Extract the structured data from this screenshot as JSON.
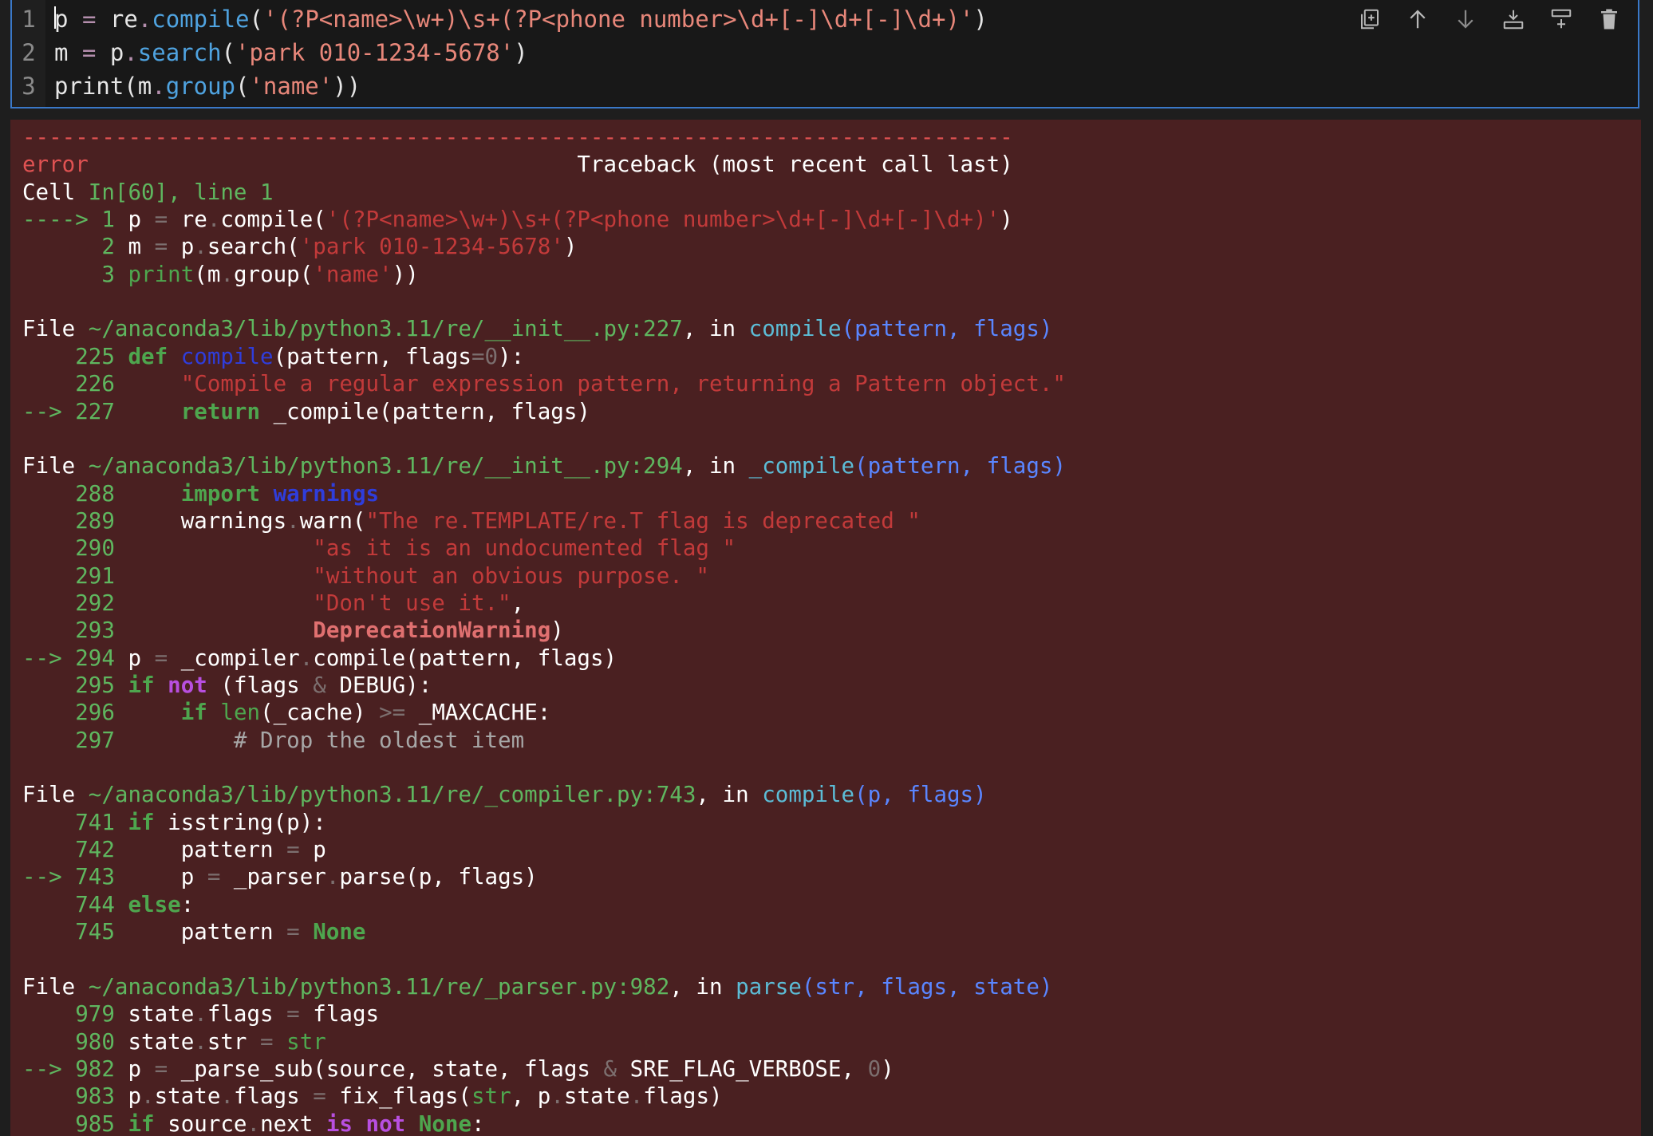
{
  "input_cell": {
    "lines": [
      {
        "no": "1",
        "parts": [
          {
            "t": "p",
            "c": "k-id"
          },
          {
            "t": " ",
            "c": "k-id"
          },
          {
            "t": "=",
            "c": "k-op"
          },
          {
            "t": " re",
            "c": "k-id"
          },
          {
            "t": ".",
            "c": "k-op"
          },
          {
            "t": "compile",
            "c": "k-fn"
          },
          {
            "t": "(",
            "c": "k-id"
          },
          {
            "t": "'(?P<name>\\w+)\\s+(?P<phone number>\\d+[-]\\d+[-]\\d+)'",
            "c": "k-str"
          },
          {
            "t": ")",
            "c": "k-id"
          }
        ]
      },
      {
        "no": "2",
        "parts": [
          {
            "t": "m ",
            "c": "k-id"
          },
          {
            "t": "=",
            "c": "k-op"
          },
          {
            "t": " p",
            "c": "k-id"
          },
          {
            "t": ".",
            "c": "k-op"
          },
          {
            "t": "search",
            "c": "k-fn"
          },
          {
            "t": "(",
            "c": "k-id"
          },
          {
            "t": "'park 010-1234-5678'",
            "c": "k-str"
          },
          {
            "t": ")",
            "c": "k-id"
          }
        ]
      },
      {
        "no": "3",
        "parts": [
          {
            "t": "print(m",
            "c": "k-id"
          },
          {
            "t": ".",
            "c": "k-op"
          },
          {
            "t": "group",
            "c": "k-fn"
          },
          {
            "t": "(",
            "c": "k-id"
          },
          {
            "t": "'name'",
            "c": "k-str"
          },
          {
            "t": "))",
            "c": "k-id"
          }
        ]
      }
    ]
  },
  "toolbar": {
    "buttons": [
      {
        "name": "copy-cell-button",
        "icon": "copy-icon",
        "title": "Copy"
      },
      {
        "name": "move-up-button",
        "icon": "arrow-up-icon",
        "title": "Move up"
      },
      {
        "name": "move-down-button",
        "icon": "arrow-down-icon",
        "title": "Move down"
      },
      {
        "name": "insert-above-button",
        "icon": "insert-above-icon",
        "title": "Insert above"
      },
      {
        "name": "insert-below-button",
        "icon": "insert-below-icon",
        "title": "Insert below"
      },
      {
        "name": "delete-cell-button",
        "icon": "trash-icon",
        "title": "Delete"
      }
    ]
  },
  "output": {
    "lines": [
      [
        {
          "t": "---------------------------------------------------------------------------",
          "c": "c-red"
        }
      ],
      [
        {
          "t": "error",
          "c": "c-red"
        },
        {
          "t": "                                     Traceback (most recent call last)",
          "c": "c-w"
        }
      ],
      [
        {
          "t": "Cell ",
          "c": "c-w"
        },
        {
          "t": "In[60], line 1",
          "c": "c-green"
        }
      ],
      [
        {
          "t": "----> 1",
          "c": "c-green"
        },
        {
          "t": " p ",
          "c": "c-w"
        },
        {
          "t": "=",
          "c": "c-gray"
        },
        {
          "t": " re",
          "c": "c-w"
        },
        {
          "t": ".",
          "c": "c-gray"
        },
        {
          "t": "compile(",
          "c": "c-w"
        },
        {
          "t": "'(?P<name>\\w+)\\s+(?P<phone number>\\d+[-]\\d+[-]\\d+)'",
          "c": "c-dred"
        },
        {
          "t": ")",
          "c": "c-w"
        }
      ],
      [
        {
          "t": "      2",
          "c": "c-green"
        },
        {
          "t": " m ",
          "c": "c-w"
        },
        {
          "t": "=",
          "c": "c-gray"
        },
        {
          "t": " p",
          "c": "c-w"
        },
        {
          "t": ".",
          "c": "c-gray"
        },
        {
          "t": "search(",
          "c": "c-w"
        },
        {
          "t": "'park 010-1234-5678'",
          "c": "c-dred"
        },
        {
          "t": ")",
          "c": "c-w"
        }
      ],
      [
        {
          "t": "      3",
          "c": "c-green"
        },
        {
          "t": " ",
          "c": "c-w"
        },
        {
          "t": "print",
          "c": "c-dgreen"
        },
        {
          "t": "(m",
          "c": "c-w"
        },
        {
          "t": ".",
          "c": "c-gray"
        },
        {
          "t": "group(",
          "c": "c-w"
        },
        {
          "t": "'name'",
          "c": "c-dred"
        },
        {
          "t": "))",
          "c": "c-w"
        }
      ],
      [
        {
          "t": "",
          "c": "c-w"
        }
      ],
      [
        {
          "t": "File ",
          "c": "c-w"
        },
        {
          "t": "~/anaconda3/lib/python3.11/re/__init__.py:227",
          "c": "c-green"
        },
        {
          "t": ", in ",
          "c": "c-w"
        },
        {
          "t": "compile",
          "c": "c-cyan"
        },
        {
          "t": "(pattern, flags)",
          "c": "c-blue"
        }
      ],
      [
        {
          "t": "    225",
          "c": "c-green"
        },
        {
          "t": " ",
          "c": "c-w"
        },
        {
          "t": "def",
          "c": "c-dgreen b"
        },
        {
          "t": " ",
          "c": "c-w"
        },
        {
          "t": "compile",
          "c": "c-dblue"
        },
        {
          "t": "(pattern, flags",
          "c": "c-w"
        },
        {
          "t": "=",
          "c": "c-gray"
        },
        {
          "t": "0",
          "c": "c-gray"
        },
        {
          "t": "):",
          "c": "c-w"
        }
      ],
      [
        {
          "t": "    226",
          "c": "c-green"
        },
        {
          "t": "     ",
          "c": "c-w"
        },
        {
          "t": "\"Compile a regular expression pattern, returning a Pattern object.\"",
          "c": "c-dred"
        }
      ],
      [
        {
          "t": "--> 227",
          "c": "c-green"
        },
        {
          "t": "     ",
          "c": "c-w"
        },
        {
          "t": "return",
          "c": "c-dgreen b"
        },
        {
          "t": " _compile(pattern, flags)",
          "c": "c-w"
        }
      ],
      [
        {
          "t": "",
          "c": "c-w"
        }
      ],
      [
        {
          "t": "File ",
          "c": "c-w"
        },
        {
          "t": "~/anaconda3/lib/python3.11/re/__init__.py:294",
          "c": "c-green"
        },
        {
          "t": ", in ",
          "c": "c-w"
        },
        {
          "t": "_compile",
          "c": "c-cyan"
        },
        {
          "t": "(pattern, flags)",
          "c": "c-blue"
        }
      ],
      [
        {
          "t": "    288",
          "c": "c-green"
        },
        {
          "t": "     ",
          "c": "c-w"
        },
        {
          "t": "import",
          "c": "c-dgreen b"
        },
        {
          "t": " ",
          "c": "c-w"
        },
        {
          "t": "warnings",
          "c": "c-dblue b"
        }
      ],
      [
        {
          "t": "    289",
          "c": "c-green"
        },
        {
          "t": "     warnings",
          "c": "c-w"
        },
        {
          "t": ".",
          "c": "c-gray"
        },
        {
          "t": "warn(",
          "c": "c-w"
        },
        {
          "t": "\"The re.TEMPLATE/re.T flag is deprecated \"",
          "c": "c-dred"
        }
      ],
      [
        {
          "t": "    290",
          "c": "c-green"
        },
        {
          "t": "               ",
          "c": "c-w"
        },
        {
          "t": "\"as it is an undocumented flag \"",
          "c": "c-dred"
        }
      ],
      [
        {
          "t": "    291",
          "c": "c-green"
        },
        {
          "t": "               ",
          "c": "c-w"
        },
        {
          "t": "\"without an obvious purpose. \"",
          "c": "c-dred"
        }
      ],
      [
        {
          "t": "    292",
          "c": "c-green"
        },
        {
          "t": "               ",
          "c": "c-w"
        },
        {
          "t": "\"Don't use it.\"",
          "c": "c-dred"
        },
        {
          "t": ",",
          "c": "c-w"
        }
      ],
      [
        {
          "t": "    293",
          "c": "c-green"
        },
        {
          "t": "               ",
          "c": "c-w"
        },
        {
          "t": "DeprecationWarning",
          "c": "c-orange b"
        },
        {
          "t": ")",
          "c": "c-w"
        }
      ],
      [
        {
          "t": "--> 294",
          "c": "c-green"
        },
        {
          "t": " p ",
          "c": "c-w"
        },
        {
          "t": "=",
          "c": "c-gray"
        },
        {
          "t": " _compiler",
          "c": "c-w"
        },
        {
          "t": ".",
          "c": "c-gray"
        },
        {
          "t": "compile(pattern, flags)",
          "c": "c-w"
        }
      ],
      [
        {
          "t": "    295",
          "c": "c-green"
        },
        {
          "t": " ",
          "c": "c-w"
        },
        {
          "t": "if",
          "c": "c-dgreen b"
        },
        {
          "t": " ",
          "c": "c-w"
        },
        {
          "t": "not",
          "c": "c-purple b"
        },
        {
          "t": " (flags ",
          "c": "c-w"
        },
        {
          "t": "&",
          "c": "c-gray"
        },
        {
          "t": " DEBUG):",
          "c": "c-w"
        }
      ],
      [
        {
          "t": "    296",
          "c": "c-green"
        },
        {
          "t": "     ",
          "c": "c-w"
        },
        {
          "t": "if",
          "c": "c-dgreen b"
        },
        {
          "t": " ",
          "c": "c-w"
        },
        {
          "t": "len",
          "c": "c-dgreen"
        },
        {
          "t": "(_cache) ",
          "c": "c-w"
        },
        {
          "t": ">=",
          "c": "c-gray"
        },
        {
          "t": " _MAXCACHE:",
          "c": "c-w"
        }
      ],
      [
        {
          "t": "    297",
          "c": "c-green"
        },
        {
          "t": "         ",
          "c": "c-w"
        },
        {
          "t": "# Drop the oldest item",
          "c": "c-comment"
        }
      ],
      [
        {
          "t": "",
          "c": "c-w"
        }
      ],
      [
        {
          "t": "File ",
          "c": "c-w"
        },
        {
          "t": "~/anaconda3/lib/python3.11/re/_compiler.py:743",
          "c": "c-green"
        },
        {
          "t": ", in ",
          "c": "c-w"
        },
        {
          "t": "compile",
          "c": "c-cyan"
        },
        {
          "t": "(p, flags)",
          "c": "c-blue"
        }
      ],
      [
        {
          "t": "    741",
          "c": "c-green"
        },
        {
          "t": " ",
          "c": "c-w"
        },
        {
          "t": "if",
          "c": "c-dgreen b"
        },
        {
          "t": " isstring(p):",
          "c": "c-w"
        }
      ],
      [
        {
          "t": "    742",
          "c": "c-green"
        },
        {
          "t": "     pattern ",
          "c": "c-w"
        },
        {
          "t": "=",
          "c": "c-gray"
        },
        {
          "t": " p",
          "c": "c-w"
        }
      ],
      [
        {
          "t": "--> 743",
          "c": "c-green"
        },
        {
          "t": "     p ",
          "c": "c-w"
        },
        {
          "t": "=",
          "c": "c-gray"
        },
        {
          "t": " _parser",
          "c": "c-w"
        },
        {
          "t": ".",
          "c": "c-gray"
        },
        {
          "t": "parse(p, flags)",
          "c": "c-w"
        }
      ],
      [
        {
          "t": "    744",
          "c": "c-green"
        },
        {
          "t": " ",
          "c": "c-w"
        },
        {
          "t": "else",
          "c": "c-dgreen b"
        },
        {
          "t": ":",
          "c": "c-w"
        }
      ],
      [
        {
          "t": "    745",
          "c": "c-green"
        },
        {
          "t": "     pattern ",
          "c": "c-w"
        },
        {
          "t": "=",
          "c": "c-gray"
        },
        {
          "t": " ",
          "c": "c-w"
        },
        {
          "t": "None",
          "c": "c-dgreen b"
        }
      ],
      [
        {
          "t": "",
          "c": "c-w"
        }
      ],
      [
        {
          "t": "File ",
          "c": "c-w"
        },
        {
          "t": "~/anaconda3/lib/python3.11/re/_parser.py:982",
          "c": "c-green"
        },
        {
          "t": ", in ",
          "c": "c-w"
        },
        {
          "t": "parse",
          "c": "c-cyan"
        },
        {
          "t": "(str, flags, state)",
          "c": "c-blue"
        }
      ],
      [
        {
          "t": "    979",
          "c": "c-green"
        },
        {
          "t": " state",
          "c": "c-w"
        },
        {
          "t": ".",
          "c": "c-gray"
        },
        {
          "t": "flags ",
          "c": "c-w"
        },
        {
          "t": "=",
          "c": "c-gray"
        },
        {
          "t": " flags",
          "c": "c-w"
        }
      ],
      [
        {
          "t": "    980",
          "c": "c-green"
        },
        {
          "t": " state",
          "c": "c-w"
        },
        {
          "t": ".",
          "c": "c-gray"
        },
        {
          "t": "str ",
          "c": "c-w"
        },
        {
          "t": "=",
          "c": "c-gray"
        },
        {
          "t": " ",
          "c": "c-w"
        },
        {
          "t": "str",
          "c": "c-dgreen"
        }
      ],
      [
        {
          "t": "--> 982",
          "c": "c-green"
        },
        {
          "t": " p ",
          "c": "c-w"
        },
        {
          "t": "=",
          "c": "c-gray"
        },
        {
          "t": " _parse_sub(source, state, flags ",
          "c": "c-w"
        },
        {
          "t": "&",
          "c": "c-gray"
        },
        {
          "t": " SRE_FLAG_VERBOSE, ",
          "c": "c-w"
        },
        {
          "t": "0",
          "c": "c-gray"
        },
        {
          "t": ")",
          "c": "c-w"
        }
      ],
      [
        {
          "t": "    983",
          "c": "c-green"
        },
        {
          "t": " p",
          "c": "c-w"
        },
        {
          "t": ".",
          "c": "c-gray"
        },
        {
          "t": "state",
          "c": "c-w"
        },
        {
          "t": ".",
          "c": "c-gray"
        },
        {
          "t": "flags ",
          "c": "c-w"
        },
        {
          "t": "=",
          "c": "c-gray"
        },
        {
          "t": " fix_flags(",
          "c": "c-w"
        },
        {
          "t": "str",
          "c": "c-dgreen"
        },
        {
          "t": ", p",
          "c": "c-w"
        },
        {
          "t": ".",
          "c": "c-gray"
        },
        {
          "t": "state",
          "c": "c-w"
        },
        {
          "t": ".",
          "c": "c-gray"
        },
        {
          "t": "flags)",
          "c": "c-w"
        }
      ],
      [
        {
          "t": "    985",
          "c": "c-green"
        },
        {
          "t": " ",
          "c": "c-w"
        },
        {
          "t": "if",
          "c": "c-dgreen b"
        },
        {
          "t": " source",
          "c": "c-w"
        },
        {
          "t": ".",
          "c": "c-gray"
        },
        {
          "t": "next ",
          "c": "c-w"
        },
        {
          "t": "is",
          "c": "c-purple b"
        },
        {
          "t": " ",
          "c": "c-w"
        },
        {
          "t": "not",
          "c": "c-purple b"
        },
        {
          "t": " ",
          "c": "c-w"
        },
        {
          "t": "None",
          "c": "c-dgreen b"
        },
        {
          "t": ":",
          "c": "c-w"
        }
      ]
    ]
  }
}
